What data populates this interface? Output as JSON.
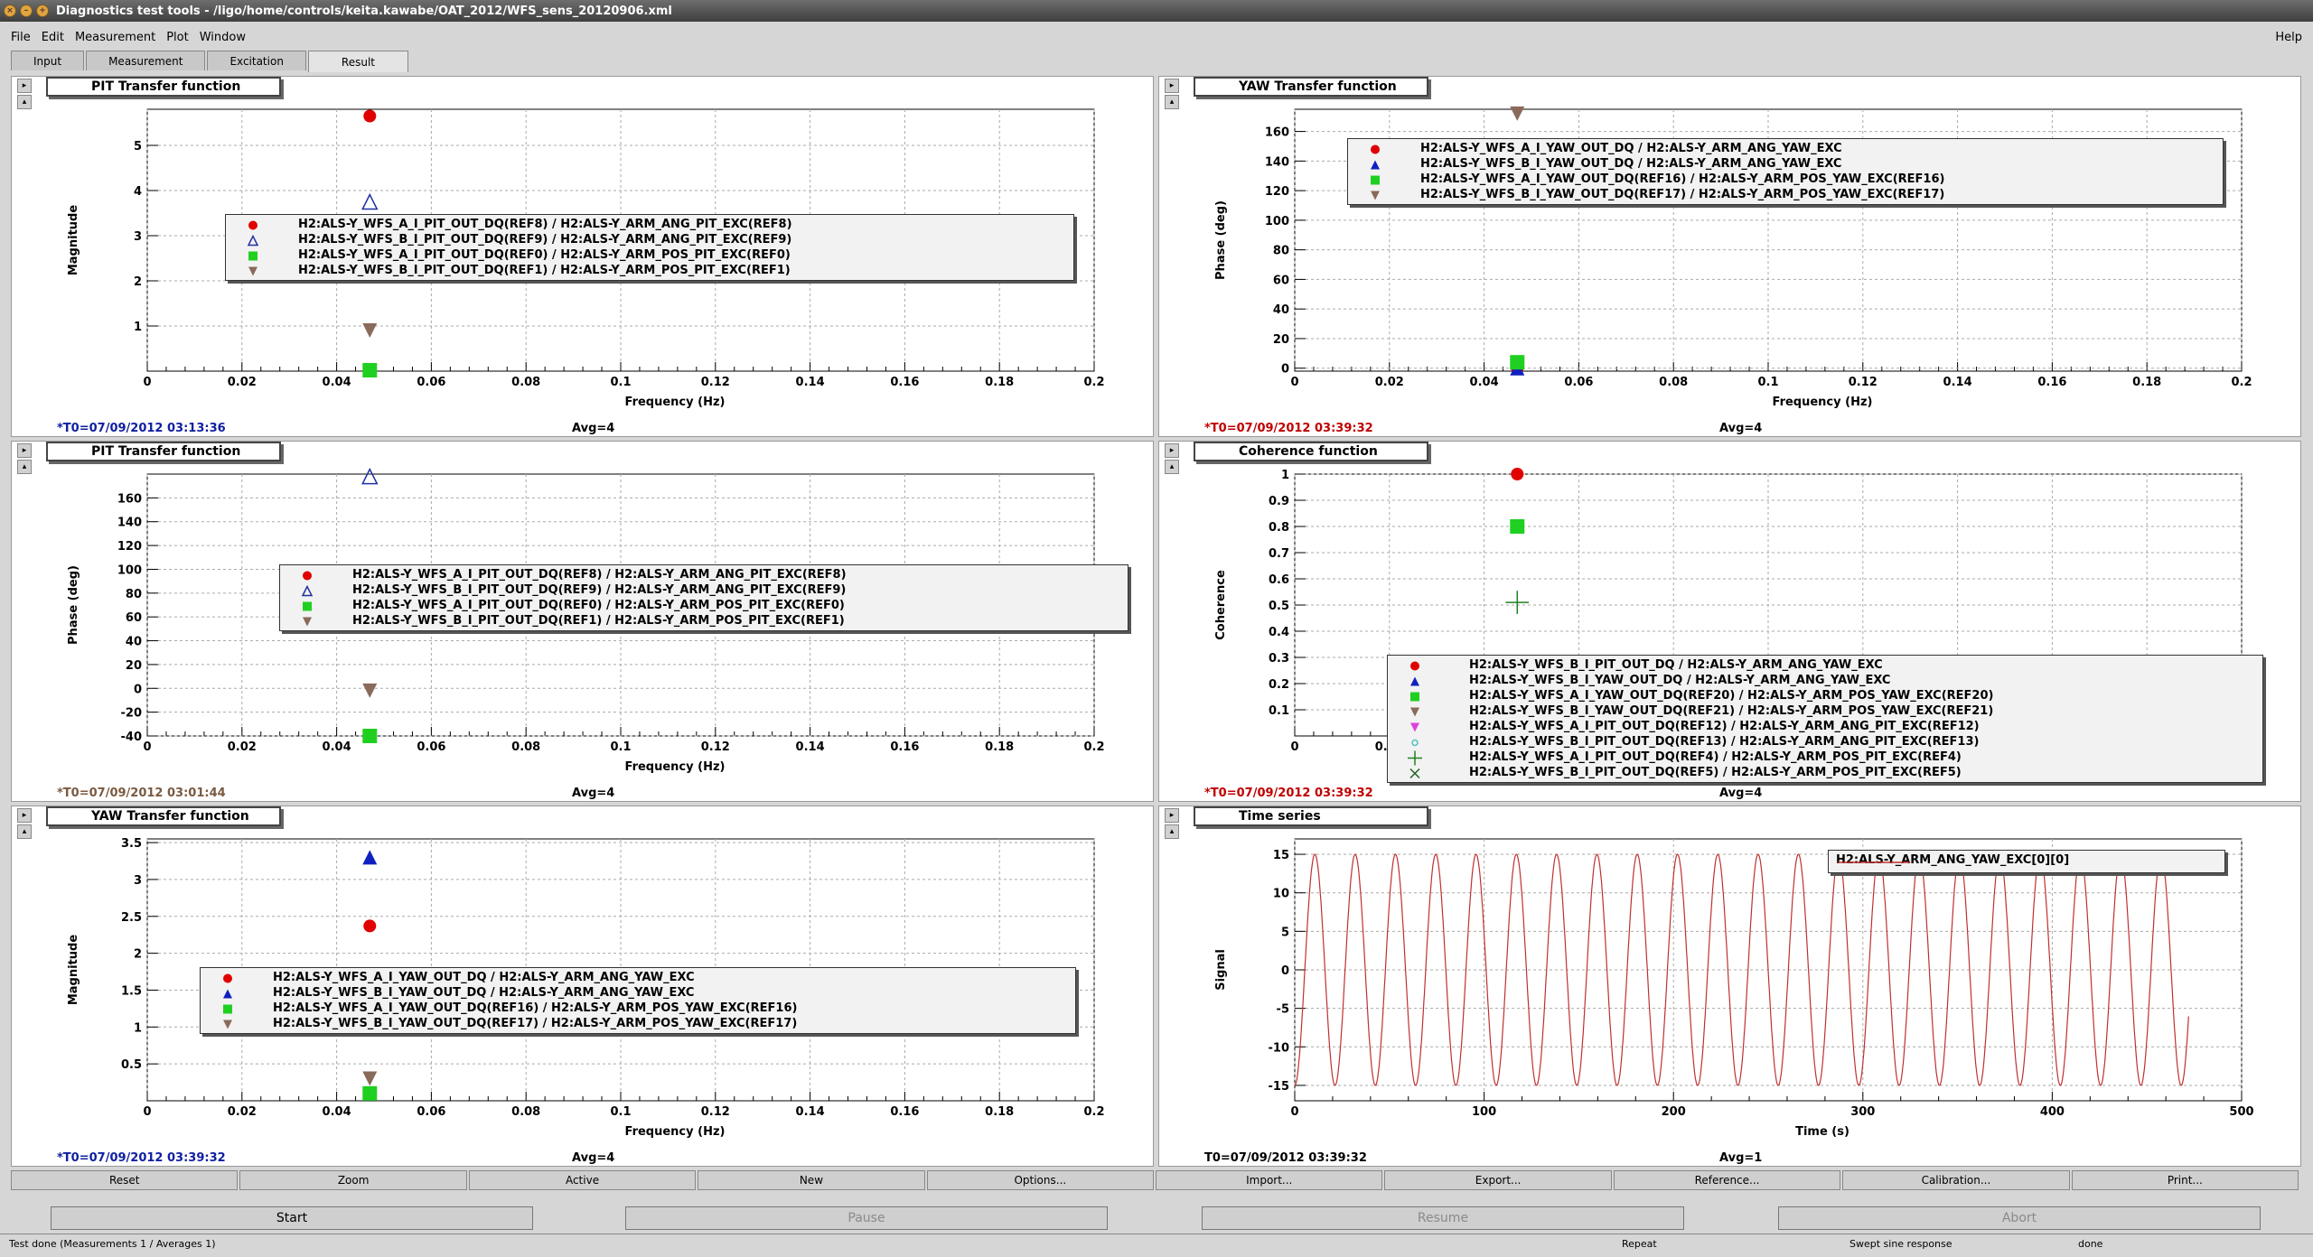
{
  "window": {
    "title": "Diagnostics test tools - /ligo/home/controls/keita.kawabe/OAT_2012/WFS_sens_20120906.xml"
  },
  "menu": {
    "items": [
      "File",
      "Edit",
      "Measurement",
      "Plot",
      "Window"
    ],
    "help": "Help"
  },
  "tabs": [
    "Input",
    "Measurement",
    "Excitation",
    "Result"
  ],
  "panels": {
    "p1": {
      "title": "PIT Transfer function",
      "t0": "*T0=07/09/2012 03:13:36",
      "avg": "Avg=4",
      "xlabel": "Frequency (Hz)",
      "ylabel": "Magnitude",
      "legend": [
        "H2:ALS-Y_WFS_A_I_PIT_OUT_DQ(REF8) / H2:ALS-Y_ARM_ANG_PIT_EXC(REF8)",
        "H2:ALS-Y_WFS_B_I_PIT_OUT_DQ(REF9) / H2:ALS-Y_ARM_ANG_PIT_EXC(REF9)",
        "H2:ALS-Y_WFS_A_I_PIT_OUT_DQ(REF0) / H2:ALS-Y_ARM_POS_PIT_EXC(REF0)",
        "H2:ALS-Y_WFS_B_I_PIT_OUT_DQ(REF1) / H2:ALS-Y_ARM_POS_PIT_EXC(REF1)"
      ]
    },
    "p2": {
      "title": "YAW Transfer function",
      "t0": "*T0=07/09/2012 03:39:32",
      "avg": "Avg=4",
      "xlabel": "Frequency (Hz)",
      "ylabel": "Phase (deg)",
      "legend": [
        "H2:ALS-Y_WFS_A_I_YAW_OUT_DQ / H2:ALS-Y_ARM_ANG_YAW_EXC",
        "H2:ALS-Y_WFS_B_I_YAW_OUT_DQ / H2:ALS-Y_ARM_ANG_YAW_EXC",
        "H2:ALS-Y_WFS_A_I_YAW_OUT_DQ(REF16) / H2:ALS-Y_ARM_POS_YAW_EXC(REF16)",
        "H2:ALS-Y_WFS_B_I_YAW_OUT_DQ(REF17) / H2:ALS-Y_ARM_POS_YAW_EXC(REF17)"
      ]
    },
    "p3": {
      "title": "PIT Transfer function",
      "t0": "*T0=07/09/2012 03:01:44",
      "avg": "Avg=4",
      "xlabel": "Frequency (Hz)",
      "ylabel": "Phase (deg)",
      "legend": [
        "H2:ALS-Y_WFS_A_I_PIT_OUT_DQ(REF8) / H2:ALS-Y_ARM_ANG_PIT_EXC(REF8)",
        "H2:ALS-Y_WFS_B_I_PIT_OUT_DQ(REF9) / H2:ALS-Y_ARM_ANG_PIT_EXC(REF9)",
        "H2:ALS-Y_WFS_A_I_PIT_OUT_DQ(REF0) / H2:ALS-Y_ARM_POS_PIT_EXC(REF0)",
        "H2:ALS-Y_WFS_B_I_PIT_OUT_DQ(REF1) / H2:ALS-Y_ARM_POS_PIT_EXC(REF1)"
      ]
    },
    "p4": {
      "title": "Coherence function",
      "t0": "*T0=07/09/2012 03:39:32",
      "avg": "Avg=4",
      "xlabel": "",
      "ylabel": "Coherence",
      "legend": [
        "H2:ALS-Y_WFS_B_I_PIT_OUT_DQ / H2:ALS-Y_ARM_ANG_YAW_EXC",
        "H2:ALS-Y_WFS_B_I_YAW_OUT_DQ / H2:ALS-Y_ARM_ANG_YAW_EXC",
        "H2:ALS-Y_WFS_A_I_YAW_OUT_DQ(REF20) / H2:ALS-Y_ARM_POS_YAW_EXC(REF20)",
        "H2:ALS-Y_WFS_B_I_YAW_OUT_DQ(REF21) / H2:ALS-Y_ARM_POS_YAW_EXC(REF21)",
        "H2:ALS-Y_WFS_A_I_PIT_OUT_DQ(REF12) / H2:ALS-Y_ARM_ANG_PIT_EXC(REF12)",
        "H2:ALS-Y_WFS_B_I_PIT_OUT_DQ(REF13) / H2:ALS-Y_ARM_ANG_PIT_EXC(REF13)",
        "H2:ALS-Y_WFS_A_I_PIT_OUT_DQ(REF4) / H2:ALS-Y_ARM_POS_PIT_EXC(REF4)",
        "H2:ALS-Y_WFS_B_I_PIT_OUT_DQ(REF5) / H2:ALS-Y_ARM_POS_PIT_EXC(REF5)"
      ]
    },
    "p5": {
      "title": "YAW Transfer function",
      "t0": "*T0=07/09/2012 03:39:32",
      "avg": "Avg=4",
      "xlabel": "Frequency (Hz)",
      "ylabel": "Magnitude",
      "legend": [
        "H2:ALS-Y_WFS_A_I_YAW_OUT_DQ / H2:ALS-Y_ARM_ANG_YAW_EXC",
        "H2:ALS-Y_WFS_B_I_YAW_OUT_DQ / H2:ALS-Y_ARM_ANG_YAW_EXC",
        "H2:ALS-Y_WFS_A_I_YAW_OUT_DQ(REF16) / H2:ALS-Y_ARM_POS_YAW_EXC(REF16)",
        "H2:ALS-Y_WFS_B_I_YAW_OUT_DQ(REF17) / H2:ALS-Y_ARM_POS_YAW_EXC(REF17)"
      ]
    },
    "p6": {
      "title": "Time series",
      "t0": "T0=07/09/2012 03:39:32",
      "avg": "Avg=1",
      "xlabel": "Time (s)",
      "ylabel": "Signal",
      "legend": [
        "H2:ALS-Y_ARM_ANG_YAW_EXC[0][0]"
      ]
    }
  },
  "chart_data": [
    {
      "type": "scatter",
      "panel": "p1",
      "xlim": [
        0,
        0.2
      ],
      "ylim": [
        0,
        5.8
      ],
      "xticks": [
        "0",
        "0.02",
        "0.04",
        "0.06",
        "0.08",
        "0.1",
        "0.12",
        "0.14",
        "0.16",
        "0.18",
        "0.2"
      ],
      "yticks": [
        1,
        2,
        3,
        4,
        5
      ],
      "series": [
        {
          "marker": "circle",
          "color": "#e00000",
          "points": [
            [
              0.047,
              5.65
            ]
          ]
        },
        {
          "marker": "triangle-open",
          "color": "#2030a0",
          "points": [
            [
              0.047,
              3.75
            ]
          ]
        },
        {
          "marker": "square",
          "color": "#20d020",
          "points": [
            [
              0.047,
              0.02
            ]
          ]
        },
        {
          "marker": "triangle-down",
          "color": "#8a6a5a",
          "points": [
            [
              0.047,
              0.9
            ]
          ]
        }
      ]
    },
    {
      "type": "scatter",
      "panel": "p2",
      "xlim": [
        0,
        0.2
      ],
      "ylim": [
        -2,
        175
      ],
      "xticks": [
        "0",
        "0.02",
        "0.04",
        "0.06",
        "0.08",
        "0.1",
        "0.12",
        "0.14",
        "0.16",
        "0.18",
        "0.2"
      ],
      "yticks": [
        0,
        20,
        40,
        60,
        80,
        100,
        120,
        140,
        160
      ],
      "series": [
        {
          "marker": "circle",
          "color": "#e00000",
          "points": [
            [
              0.047,
              0
            ]
          ]
        },
        {
          "marker": "triangle",
          "color": "#1020c0",
          "points": [
            [
              0.047,
              0
            ]
          ]
        },
        {
          "marker": "square",
          "color": "#20d020",
          "points": [
            [
              0.047,
              4
            ]
          ]
        },
        {
          "marker": "triangle-down",
          "color": "#8a6a5a",
          "points": [
            [
              0.047,
              172
            ]
          ]
        }
      ]
    },
    {
      "type": "scatter",
      "panel": "p3",
      "xlim": [
        0,
        0.2
      ],
      "ylim": [
        -40,
        180
      ],
      "xticks": [
        "0",
        "0.02",
        "0.04",
        "0.06",
        "0.08",
        "0.1",
        "0.12",
        "0.14",
        "0.16",
        "0.18",
        "0.2"
      ],
      "yticks": [
        -40,
        -20,
        0,
        20,
        40,
        60,
        80,
        100,
        120,
        140,
        160
      ],
      "series": [
        {
          "marker": "circle",
          "color": "#e00000",
          "points": []
        },
        {
          "marker": "triangle-open",
          "color": "#2030a0",
          "points": [
            [
              0.047,
              178
            ]
          ]
        },
        {
          "marker": "square",
          "color": "#20d020",
          "points": [
            [
              0.047,
              -40
            ]
          ]
        },
        {
          "marker": "triangle-down",
          "color": "#8a6a5a",
          "points": [
            [
              0.047,
              -2
            ]
          ]
        }
      ]
    },
    {
      "type": "scatter",
      "panel": "p4",
      "xlim": [
        0,
        0.2
      ],
      "ylim": [
        0,
        1
      ],
      "xticks": [
        "0",
        "0.02"
      ],
      "yticks": [
        0.1,
        0.2,
        0.3,
        0.4,
        0.5,
        0.6,
        0.7,
        0.8,
        0.9,
        1
      ],
      "series": [
        {
          "marker": "circle",
          "color": "#e00000",
          "points": [
            [
              0.047,
              1.0
            ]
          ]
        },
        {
          "marker": "triangle",
          "color": "#1020c0",
          "points": []
        },
        {
          "marker": "square",
          "color": "#20d020",
          "points": [
            [
              0.047,
              0.8
            ]
          ]
        },
        {
          "marker": "triangle-down",
          "color": "#8a6a5a",
          "points": []
        },
        {
          "marker": "triangle-down",
          "color": "#e040e0",
          "points": []
        },
        {
          "marker": "circle-open",
          "color": "#50c0c0",
          "points": []
        },
        {
          "marker": "plus",
          "color": "#208020",
          "points": [
            [
              0.047,
              0.51
            ]
          ]
        },
        {
          "marker": "cross",
          "color": "#206020",
          "points": []
        }
      ]
    },
    {
      "type": "scatter",
      "panel": "p5",
      "xlim": [
        0,
        0.2
      ],
      "ylim": [
        0,
        3.55
      ],
      "xticks": [
        "0",
        "0.02",
        "0.04",
        "0.06",
        "0.08",
        "0.1",
        "0.12",
        "0.14",
        "0.16",
        "0.18",
        "0.2"
      ],
      "yticks": [
        0.5,
        1,
        1.5,
        2,
        2.5,
        3,
        3.5
      ],
      "series": [
        {
          "marker": "circle",
          "color": "#e00000",
          "points": [
            [
              0.047,
              2.37
            ]
          ]
        },
        {
          "marker": "triangle",
          "color": "#1020c0",
          "points": [
            [
              0.047,
              3.3
            ]
          ]
        },
        {
          "marker": "square",
          "color": "#20d020",
          "points": [
            [
              0.047,
              0.1
            ]
          ]
        },
        {
          "marker": "triangle-down",
          "color": "#8a6a5a",
          "points": [
            [
              0.047,
              0.3
            ]
          ]
        }
      ]
    },
    {
      "type": "line",
      "panel": "p6",
      "xlim": [
        0,
        500
      ],
      "ylim": [
        -17,
        17
      ],
      "xticks": [
        "0",
        "100",
        "200",
        "300",
        "400",
        "500"
      ],
      "yticks": [
        -15,
        -10,
        -5,
        0,
        5,
        10,
        15
      ],
      "series": [
        {
          "name": "H2:ALS-Y_ARM_ANG_YAW_EXC[0][0]",
          "color": "#c03030",
          "amplitude": 15,
          "frequency": 0.047,
          "tmax": 472
        }
      ]
    }
  ],
  "toolbar": [
    "Reset",
    "Zoom",
    "Active",
    "New",
    "Options...",
    "Import...",
    "Export...",
    "Reference...",
    "Calibration...",
    "Print..."
  ],
  "controls": {
    "start": "Start",
    "pause": "Pause",
    "resume": "Resume",
    "abort": "Abort"
  },
  "status": {
    "message": "Test done (Measurements 1 / Averages 1)",
    "repeat": "Repeat",
    "mode": "Swept sine response",
    "state": "done"
  }
}
